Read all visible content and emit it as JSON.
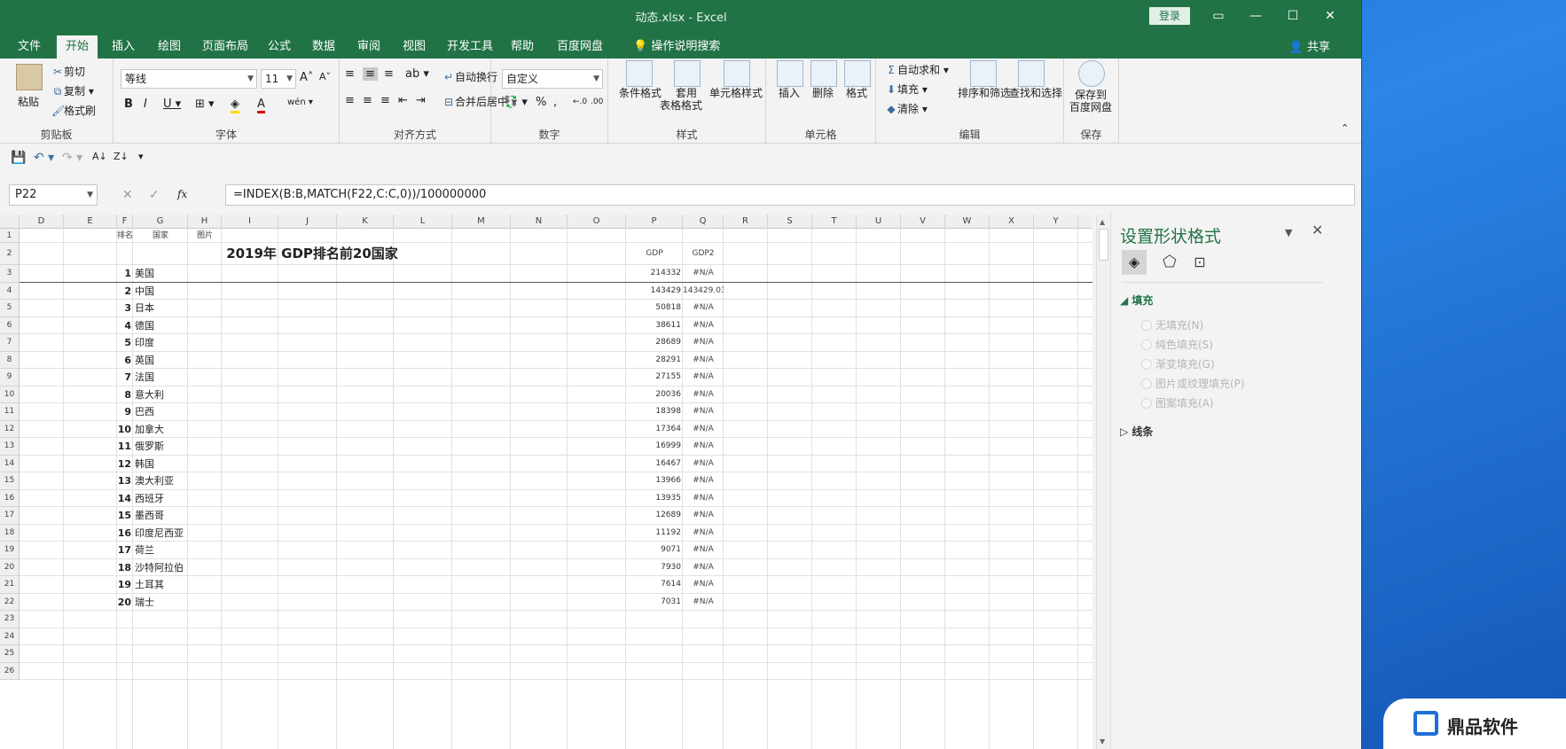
{
  "window": {
    "title": "动态.xlsx  -  Excel",
    "login": "登录",
    "share": "共享"
  },
  "menu": [
    {
      "label": "文件"
    },
    {
      "label": "开始",
      "active": true
    },
    {
      "label": "插入"
    },
    {
      "label": "绘图"
    },
    {
      "label": "页面布局"
    },
    {
      "label": "公式"
    },
    {
      "label": "数据"
    },
    {
      "label": "审阅"
    },
    {
      "label": "视图"
    },
    {
      "label": "开发工具"
    },
    {
      "label": "帮助"
    },
    {
      "label": "百度网盘"
    },
    {
      "label": "操作说明搜索"
    }
  ],
  "ribbon": {
    "clipboard": {
      "label": "剪贴板",
      "paste": "粘贴",
      "cut": "剪切",
      "copy": "复制",
      "painter": "格式刷"
    },
    "font": {
      "label": "字体",
      "name": "等线",
      "size": "11"
    },
    "align": {
      "label": "对齐方式",
      "wrap": "自动换行",
      "merge": "合并后居中"
    },
    "number": {
      "label": "数字",
      "format": "自定义"
    },
    "styles": {
      "label": "样式",
      "cond": "条件格式",
      "table1": "套用",
      "table2": "表格格式",
      "cell": "单元格样式"
    },
    "cells": {
      "label": "单元格",
      "insert": "插入",
      "delete": "删除",
      "format": "格式"
    },
    "edit": {
      "label": "编辑",
      "autosum": "自动求和",
      "fill": "填充",
      "clear": "清除",
      "sort": "排序和筛选",
      "find": "查找和选择"
    },
    "save": {
      "label": "保存",
      "btn1": "保存到",
      "btn2": "百度网盘"
    }
  },
  "formula": {
    "cell": "P22",
    "fx": "fx",
    "text": "=INDEX(B:B,MATCH(F22,C:C,0))/100000000"
  },
  "columns": [
    "D",
    "E",
    "F",
    "G",
    "H",
    "I",
    "J",
    "K",
    "L",
    "M",
    "N",
    "O",
    "P",
    "Q",
    "R",
    "S",
    "T",
    "U",
    "V",
    "W",
    "X",
    "Y"
  ],
  "header_row": {
    "rank": "排名",
    "country": "国家",
    "pic": "图片"
  },
  "sheet_title": "2019年 GDP排名前20国家",
  "gdp_header": "GDP",
  "gdp2_header": "GDP2",
  "rows": [
    {
      "rank": "1",
      "country": "美国",
      "gdp": "214332",
      "gdp2": "#N/A"
    },
    {
      "rank": "2",
      "country": "中国",
      "gdp": "143429",
      "gdp2": "143429.03"
    },
    {
      "rank": "3",
      "country": "日本",
      "gdp": "50818",
      "gdp2": "#N/A"
    },
    {
      "rank": "4",
      "country": "德国",
      "gdp": "38611",
      "gdp2": "#N/A"
    },
    {
      "rank": "5",
      "country": "印度",
      "gdp": "28689",
      "gdp2": "#N/A"
    },
    {
      "rank": "6",
      "country": "英国",
      "gdp": "28291",
      "gdp2": "#N/A"
    },
    {
      "rank": "7",
      "country": "法国",
      "gdp": "27155",
      "gdp2": "#N/A"
    },
    {
      "rank": "8",
      "country": "意大利",
      "gdp": "20036",
      "gdp2": "#N/A"
    },
    {
      "rank": "9",
      "country": "巴西",
      "gdp": "18398",
      "gdp2": "#N/A"
    },
    {
      "rank": "10",
      "country": "加拿大",
      "gdp": "17364",
      "gdp2": "#N/A"
    },
    {
      "rank": "11",
      "country": "俄罗斯",
      "gdp": "16999",
      "gdp2": "#N/A"
    },
    {
      "rank": "12",
      "country": "韩国",
      "gdp": "16467",
      "gdp2": "#N/A"
    },
    {
      "rank": "13",
      "country": "澳大利亚",
      "gdp": "13966",
      "gdp2": "#N/A"
    },
    {
      "rank": "14",
      "country": "西班牙",
      "gdp": "13935",
      "gdp2": "#N/A"
    },
    {
      "rank": "15",
      "country": "墨西哥",
      "gdp": "12689",
      "gdp2": "#N/A"
    },
    {
      "rank": "16",
      "country": "印度尼西亚",
      "gdp": "11192",
      "gdp2": "#N/A"
    },
    {
      "rank": "17",
      "country": "荷兰",
      "gdp": "9071",
      "gdp2": "#N/A"
    },
    {
      "rank": "18",
      "country": "沙特阿拉伯",
      "gdp": "7930",
      "gdp2": "#N/A"
    },
    {
      "rank": "19",
      "country": "土耳其",
      "gdp": "7614",
      "gdp2": "#N/A"
    },
    {
      "rank": "20",
      "country": "瑞士",
      "gdp": "7031",
      "gdp2": "#N/A"
    }
  ],
  "row_numbers": [
    "1",
    "2",
    "3",
    "4",
    "5",
    "6",
    "7",
    "8",
    "9",
    "10",
    "11",
    "12",
    "13",
    "14",
    "15",
    "16",
    "17",
    "18",
    "19",
    "20",
    "21",
    "22",
    "23",
    "24",
    "25",
    "26"
  ],
  "pane": {
    "title": "设置形状格式",
    "fill_section": "填充",
    "options": [
      "无填充(N)",
      "纯色填充(S)",
      "渐变填充(G)",
      "图片或纹理填充(P)",
      "图案填充(A)"
    ],
    "line_section": "线条"
  },
  "watermark": {
    "text": "鼎品软件"
  }
}
